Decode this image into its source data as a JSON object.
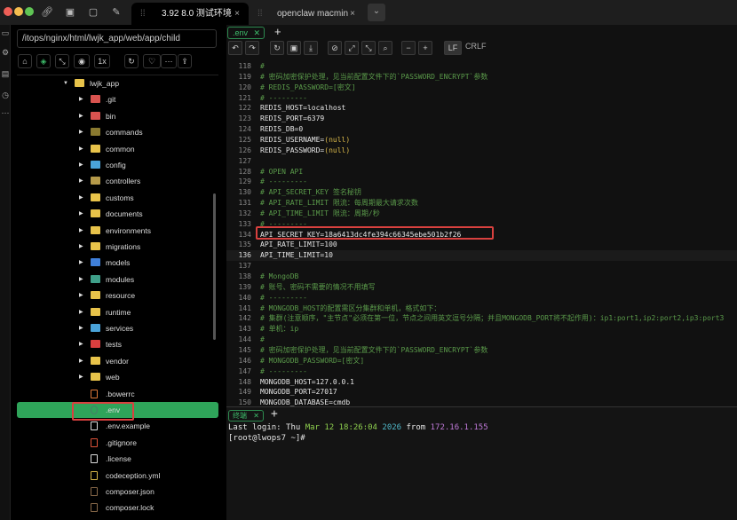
{
  "window": {
    "tabs": [
      {
        "label": "3.92 8.0 测试环境",
        "close": "×"
      },
      {
        "label": "openclaw macmin",
        "close": "×"
      }
    ],
    "dropdown": "⌄"
  },
  "sidebar": {
    "path": "/itops/nginx/html/lwjk_app/web/app/child",
    "speed": "1x",
    "items": [
      {
        "label": "lwjk_app",
        "type": "folder",
        "color": "#e8c34a",
        "expanded": true
      },
      {
        "label": ".git",
        "type": "folder",
        "color": "#d9534f"
      },
      {
        "label": "bin",
        "type": "folder",
        "color": "#d9534f"
      },
      {
        "label": "commands",
        "type": "folder",
        "color": "#8a7a30"
      },
      {
        "label": "common",
        "type": "folder",
        "color": "#e8c34a"
      },
      {
        "label": "config",
        "type": "folder",
        "color": "#4aa3d9"
      },
      {
        "label": "controllers",
        "type": "folder",
        "color": "#b59a4a"
      },
      {
        "label": "customs",
        "type": "folder",
        "color": "#e8c34a"
      },
      {
        "label": "documents",
        "type": "folder",
        "color": "#e8c34a"
      },
      {
        "label": "environments",
        "type": "folder",
        "color": "#e8c34a"
      },
      {
        "label": "migrations",
        "type": "folder",
        "color": "#e8c34a"
      },
      {
        "label": "models",
        "type": "folder",
        "color": "#3f7fd9"
      },
      {
        "label": "modules",
        "type": "folder",
        "color": "#3fa08a"
      },
      {
        "label": "resource",
        "type": "folder",
        "color": "#e8c34a"
      },
      {
        "label": "runtime",
        "type": "folder",
        "color": "#e8c34a"
      },
      {
        "label": "services",
        "type": "folder",
        "color": "#4aa3d9"
      },
      {
        "label": "tests",
        "type": "folder",
        "color": "#d93f3f"
      },
      {
        "label": "vendor",
        "type": "folder",
        "color": "#e8c34a"
      },
      {
        "label": "web",
        "type": "folder",
        "color": "#e8c34a"
      },
      {
        "label": ".bowerrc",
        "type": "file",
        "color": "#e07a3a"
      },
      {
        "label": ".env",
        "type": "file",
        "color": "#4a7a6a",
        "selected": true
      },
      {
        "label": ".env.example",
        "type": "file",
        "color": "#dddddd"
      },
      {
        "label": ".gitignore",
        "type": "file",
        "color": "#e0533a"
      },
      {
        "label": ".license",
        "type": "file",
        "color": "#dddddd"
      },
      {
        "label": "codeception.yml",
        "type": "file",
        "color": "#d9b84a"
      },
      {
        "label": "composer.json",
        "type": "file",
        "color": "#8a6a4a"
      },
      {
        "label": "composer.lock",
        "type": "file",
        "color": "#8a6a4a"
      }
    ]
  },
  "editor": {
    "tab": ".env",
    "tab_close": "✕",
    "add": "+",
    "eol_lf": "LF",
    "eol_crlf": "CRLF",
    "lines": [
      {
        "n": "118",
        "t": "#"
      },
      {
        "n": "119",
        "t": "# 密码加密保护处理，见当前配置文件下的`PASSWORD_ENCRYPT`参数"
      },
      {
        "n": "120",
        "t": "# REDIS_PASSWORD=[密文]"
      },
      {
        "n": "121",
        "t": "# ---------"
      },
      {
        "n": "122",
        "t": "REDIS_HOST=localhost"
      },
      {
        "n": "123",
        "t": "REDIS_PORT=6379"
      },
      {
        "n": "124",
        "t": "REDIS_DB=0"
      },
      {
        "n": "125",
        "t": "REDIS_USERNAME=(null)"
      },
      {
        "n": "126",
        "t": "REDIS_PASSWORD=(null)"
      },
      {
        "n": "127",
        "t": ""
      },
      {
        "n": "128",
        "t": "# OPEN API"
      },
      {
        "n": "129",
        "t": "# ---------"
      },
      {
        "n": "130",
        "t": "# API_SECRET_KEY 签名秘钥"
      },
      {
        "n": "131",
        "t": "# API_RATE_LIMIT 限流：每周期最大请求次数"
      },
      {
        "n": "132",
        "t": "# API_TIME_LIMIT 限流：周期/秒"
      },
      {
        "n": "133",
        "t": "# ---------"
      },
      {
        "n": "134",
        "t": "API_SECRET_KEY=18a6413dc4fe394c66345ebe501b2f26"
      },
      {
        "n": "135",
        "t": "API_RATE_LIMIT=100"
      },
      {
        "n": "136",
        "t": "API_TIME_LIMIT=10"
      },
      {
        "n": "137",
        "t": ""
      },
      {
        "n": "138",
        "t": "# MongoDB"
      },
      {
        "n": "139",
        "t": "# 账号、密码不需要的情况不用填写"
      },
      {
        "n": "140",
        "t": "# ---------"
      },
      {
        "n": "141",
        "t": "# MONGODB_HOST的配置需区分集群和单机，格式如下："
      },
      {
        "n": "142",
        "t": "# 集群(注意顺序，\"主节点\"必须在第一位，节点之间用英文逗号分隔；并且MONGODB_PORT将不起作用)：ip1:port1,ip2:port2,ip3:port3"
      },
      {
        "n": "143",
        "t": "# 单机：ip"
      },
      {
        "n": "144",
        "t": "#"
      },
      {
        "n": "145",
        "t": "# 密码加密保护处理，见当前配置文件下的`PASSWORD_ENCRYPT`参数"
      },
      {
        "n": "146",
        "t": "# MONGODB_PASSWORD=[密文]"
      },
      {
        "n": "147",
        "t": "# ---------"
      },
      {
        "n": "148",
        "t": "MONGODB_HOST=127.0.0.1"
      },
      {
        "n": "149",
        "t": "MONGODB_PORT=27017"
      },
      {
        "n": "150",
        "t": "MONGODB_DATABASE=cmdb"
      }
    ]
  },
  "terminal": {
    "tab": "终端",
    "tab_close": "✕",
    "add": "+",
    "login_prefix": "Last login: Thu ",
    "login_date": "Mar 12 18:26:04",
    "login_year": "2026",
    "login_from": " from ",
    "login_ip": "172.16.1.155",
    "prompt": "[root@lwops7 ~]#"
  },
  "colors": {
    "accent": "#2fa45a",
    "highlight_box": "#d9413f",
    "comment": "#5a9a4a"
  }
}
